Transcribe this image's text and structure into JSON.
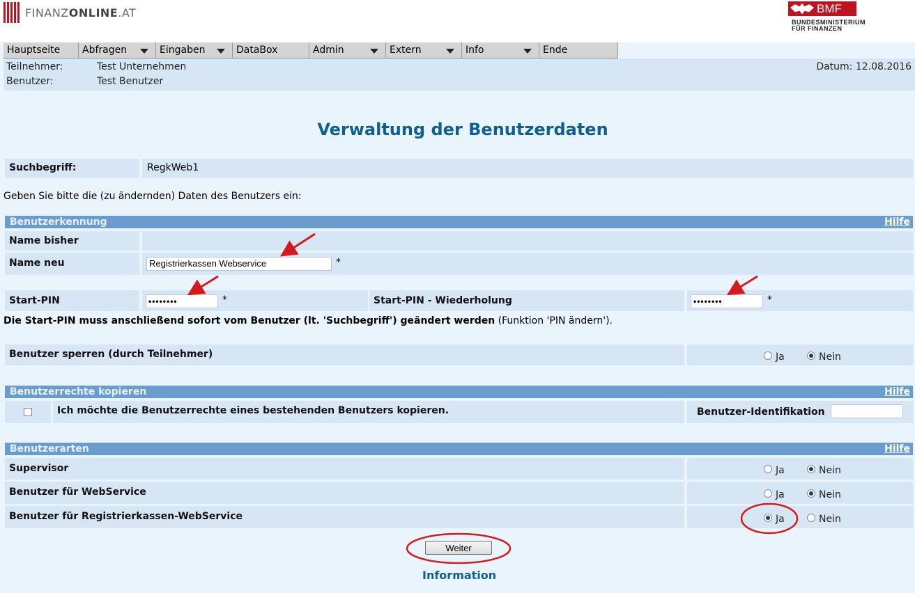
{
  "header": {
    "logo_text_light": "FINANZ",
    "logo_text_bold": "ONLINE",
    "logo_text_suffix": ".AT",
    "bmf_label": "BMF",
    "bmf_sub1": "BUNDESMINISTERIUM",
    "bmf_sub2": "FÜR FINANZEN"
  },
  "menu": [
    {
      "label": "Hauptseite",
      "dropdown": false
    },
    {
      "label": "Abfragen",
      "dropdown": true
    },
    {
      "label": "Eingaben",
      "dropdown": true
    },
    {
      "label": "DataBox",
      "dropdown": false
    },
    {
      "label": "Admin",
      "dropdown": true
    },
    {
      "label": "Extern",
      "dropdown": true
    },
    {
      "label": "Info",
      "dropdown": true
    },
    {
      "label": "Ende",
      "dropdown": false
    }
  ],
  "info": {
    "teilnehmer_label": "Teilnehmer:",
    "teilnehmer_value": "Test Unternehmen",
    "benutzer_label": "Benutzer:",
    "benutzer_value": "Test Benutzer",
    "datum": "Datum: 12.08.2016"
  },
  "page_title": "Verwaltung der Benutzerdaten",
  "suchbegriff": {
    "label": "Suchbegriff:",
    "value": "RegkWeb1"
  },
  "instruction": "Geben Sie bitte die (zu ändernden) Daten des Benutzers ein:",
  "section_benutzerkennung": {
    "title": "Benutzerkennung",
    "help": "Hilfe",
    "name_bisher_label": "Name bisher",
    "name_neu_label": "Name neu",
    "name_neu_value": "Registrierkassen Webservice",
    "required": "*"
  },
  "pin": {
    "start_pin_label": "Start-PIN",
    "start_pin_value": "••••••••",
    "repeat_label": "Start-PIN - Wiederholung",
    "repeat_value": "••••••••",
    "note_bold": "Die Start-PIN muss anschließend sofort vom Benutzer (lt. 'Suchbegriff') geändert werden",
    "note_normal": " (Funktion 'PIN ändern')."
  },
  "sperren": {
    "label": "Benutzer sperren (durch Teilnehmer)",
    "ja": "Ja",
    "nein": "Nein",
    "selected": "Nein"
  },
  "section_rechte": {
    "title": "Benutzerrechte kopieren",
    "help": "Hilfe",
    "copy_label": "Ich möchte die Benutzerrechte eines bestehenden Benutzers kopieren.",
    "id_label": "Benutzer-Identifikation",
    "id_value": ""
  },
  "section_arten": {
    "title": "Benutzerarten",
    "help": "Hilfe",
    "rows": [
      {
        "label": "Supervisor",
        "selected": "Nein"
      },
      {
        "label": "Benutzer für WebService",
        "selected": "Nein"
      },
      {
        "label": "Benutzer für Registrierkassen-WebService",
        "selected": "Ja"
      }
    ],
    "ja": "Ja",
    "nein": "Nein"
  },
  "weiter_button": "Weiter",
  "information_link": "Information",
  "colors": {
    "accent": "#0f5f91",
    "section": "#6a9ccd",
    "cell": "#d6e6f5",
    "annotation": "#d41a1a"
  }
}
